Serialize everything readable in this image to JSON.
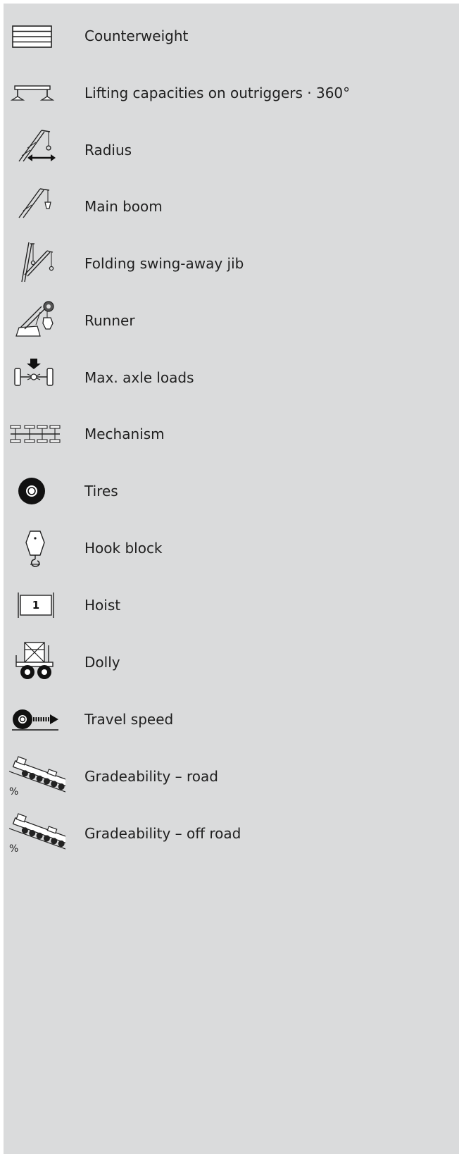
{
  "legend": {
    "items": [
      {
        "icon": "counterweight-icon",
        "label": "Counterweight"
      },
      {
        "icon": "outriggers-icon",
        "label": "Lifting capacities on outriggers · 360°"
      },
      {
        "icon": "radius-icon",
        "label": "Radius"
      },
      {
        "icon": "main-boom-icon",
        "label": "Main boom"
      },
      {
        "icon": "folding-jib-icon",
        "label": "Folding swing-away jib"
      },
      {
        "icon": "runner-icon",
        "label": "Runner"
      },
      {
        "icon": "axle-load-icon",
        "label": "Max. axle loads"
      },
      {
        "icon": "mechanism-icon",
        "label": "Mechanism"
      },
      {
        "icon": "tire-icon",
        "label": "Tires"
      },
      {
        "icon": "hook-block-icon",
        "label": "Hook block"
      },
      {
        "icon": "hoist-icon",
        "label": "Hoist",
        "badge": "1"
      },
      {
        "icon": "dolly-icon",
        "label": "Dolly"
      },
      {
        "icon": "travel-speed-icon",
        "label": "Travel speed"
      },
      {
        "icon": "gradeability-road-icon",
        "label": "Gradeability – road",
        "unit": "%"
      },
      {
        "icon": "gradeability-offroad-icon",
        "label": "Gradeability – off road",
        "unit": "%"
      }
    ]
  }
}
